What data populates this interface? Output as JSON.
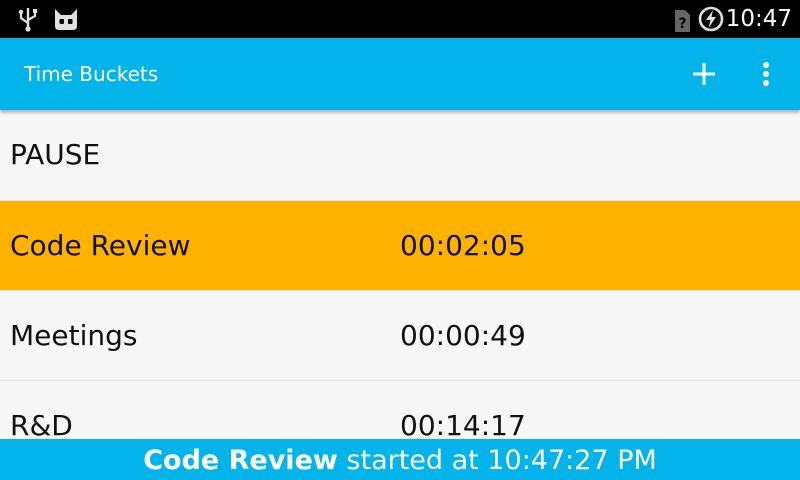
{
  "status_bar": {
    "clock": "10:47",
    "icons": [
      "usb-icon",
      "cyanogenmod-cat-icon",
      "no-sim-icon",
      "battery-charging-icon"
    ]
  },
  "action_bar": {
    "title": "Time Buckets",
    "actions": [
      "add-icon",
      "overflow-menu-icon"
    ],
    "color": "#03b4ea"
  },
  "list": {
    "pause_label": "PAUSE",
    "active_color": "#ffb300",
    "buckets": [
      {
        "name": "Code Review",
        "time": "00:02:05",
        "active": true
      },
      {
        "name": "Meetings",
        "time": "00:00:49",
        "active": false
      },
      {
        "name": "R&D",
        "time": "00:14:17",
        "active": false
      }
    ]
  },
  "banner": {
    "bucket": "Code Review",
    "text": "started at 10:47:27 PM"
  }
}
